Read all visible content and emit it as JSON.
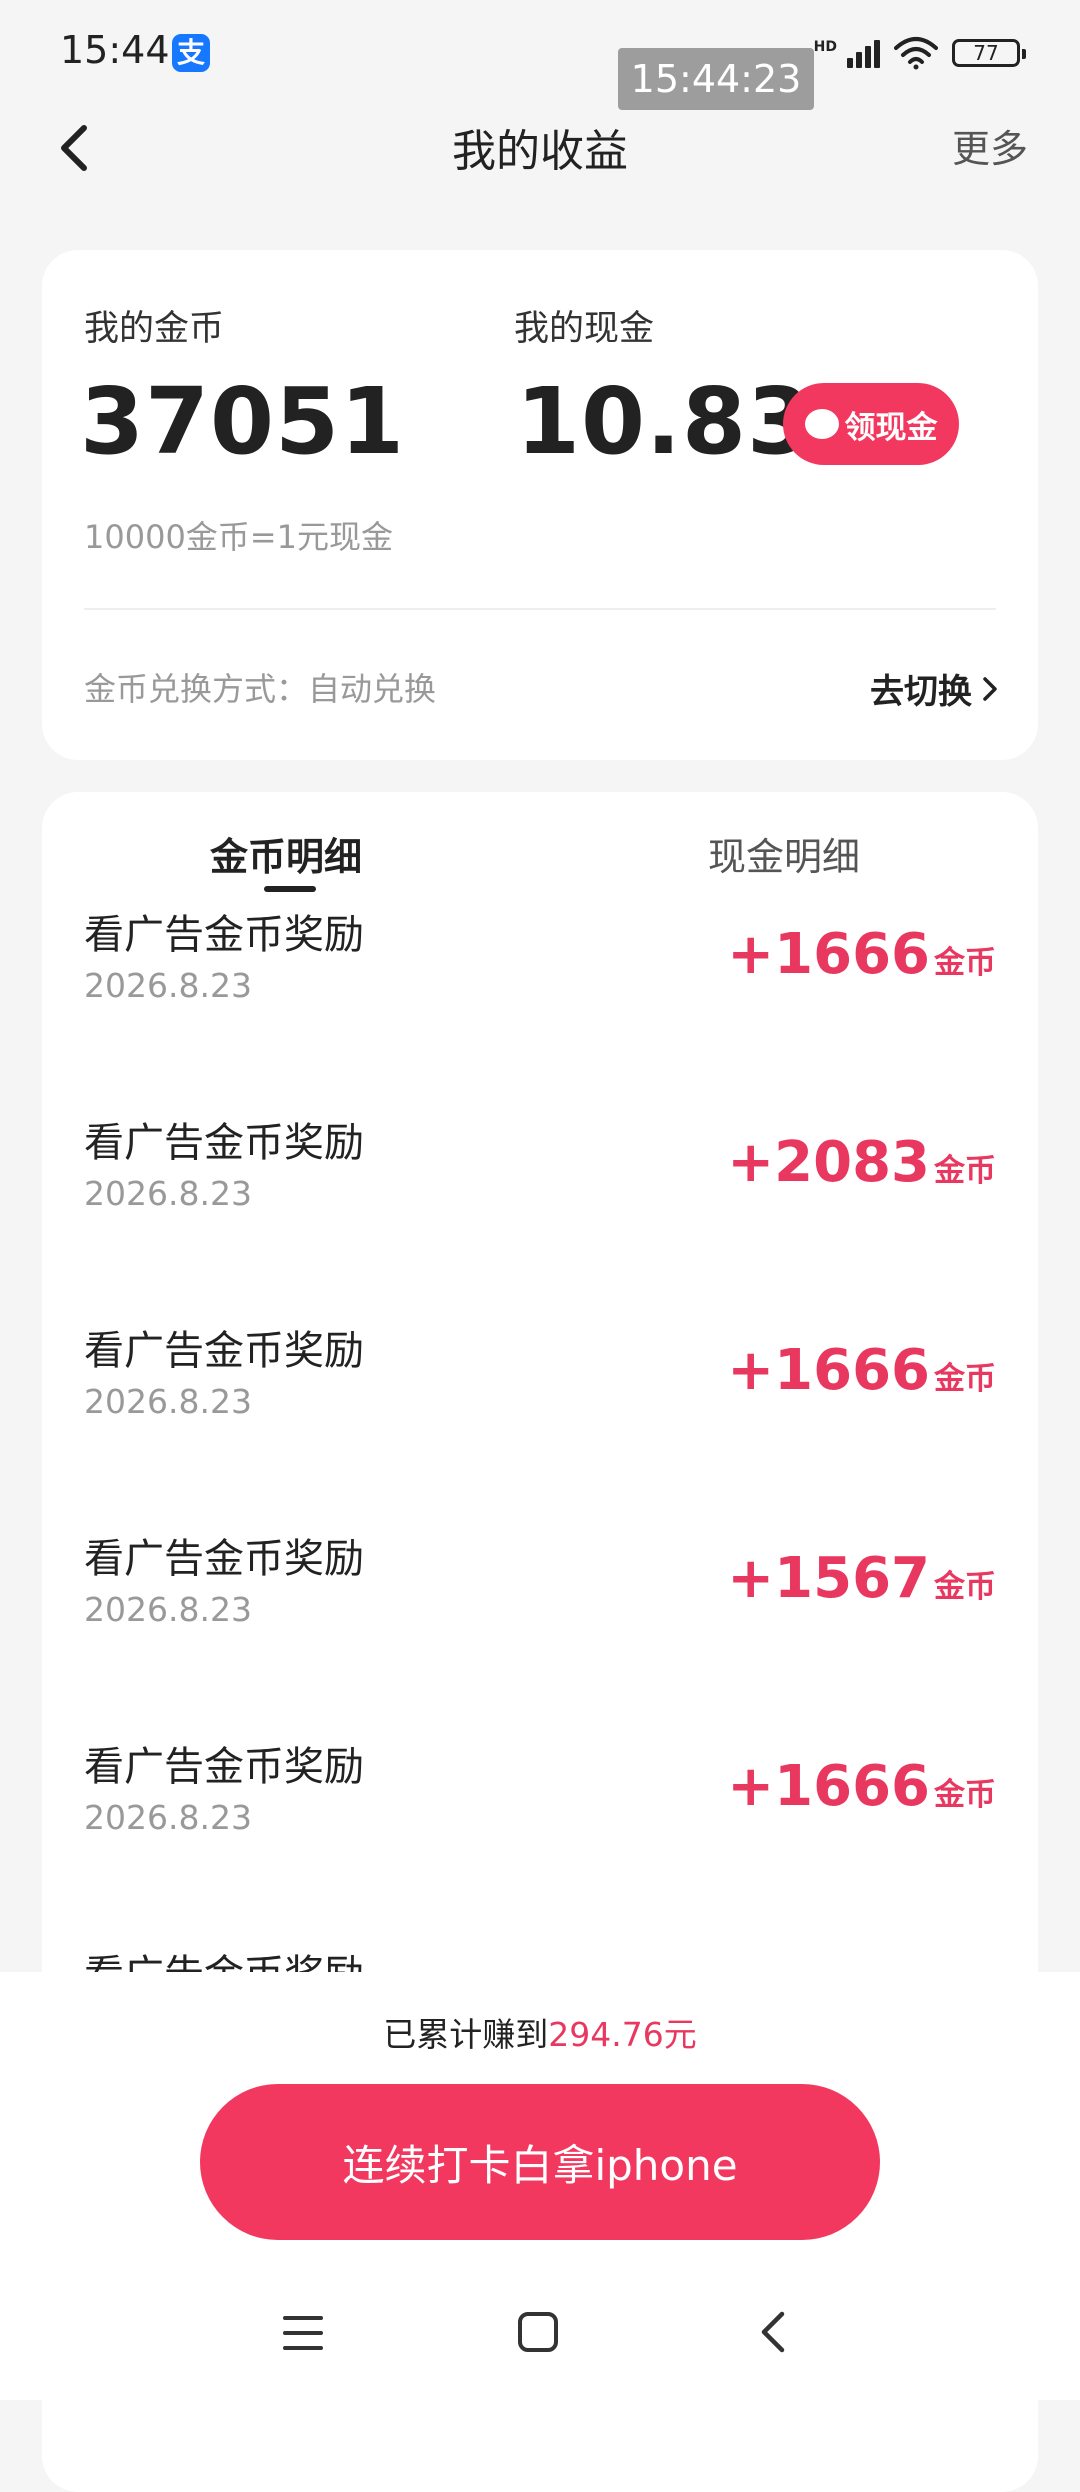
{
  "status_bar": {
    "time": "15:44",
    "battery": "77",
    "network": "HD"
  },
  "time_overlay": "15:44:23",
  "header": {
    "title": "我的收益",
    "more": "更多"
  },
  "summary": {
    "coins_label": "我的金币",
    "coins_value": "37051",
    "cash_label": "我的现金",
    "cash_value": "10.83",
    "cash_button": "领现金",
    "rate": "10000金币=1元现金",
    "exchange_mode": "金币兑换方式：自动兑换",
    "switch_label": "去切换"
  },
  "tabs": [
    {
      "label": "金币明细",
      "active": true
    },
    {
      "label": "现金明细",
      "active": false
    }
  ],
  "records": [
    {
      "title": "看广告金币奖励",
      "date": "2026.8.23",
      "amount": "+1666",
      "unit": "金币"
    },
    {
      "title": "看广告金币奖励",
      "date": "2026.8.23",
      "amount": "+2083",
      "unit": "金币"
    },
    {
      "title": "看广告金币奖励",
      "date": "2026.8.23",
      "amount": "+1666",
      "unit": "金币"
    },
    {
      "title": "看广告金币奖励",
      "date": "2026.8.23",
      "amount": "+1567",
      "unit": "金币"
    },
    {
      "title": "看广告金币奖励",
      "date": "2026.8.23",
      "amount": "+1666",
      "unit": "金币"
    },
    {
      "title": "看广告金币奖励"
    }
  ],
  "footer": {
    "earned_prefix": "已累计赚到",
    "earned_value": "294.76元",
    "checkin_button": "连续打卡白拿iphone"
  },
  "colors": {
    "accent": "#f2385f",
    "amount": "#e8385f",
    "background": "#f5f5f5"
  }
}
